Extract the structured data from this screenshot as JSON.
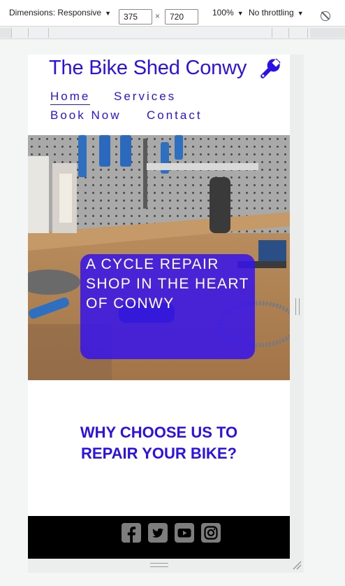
{
  "devtools": {
    "dimensions_label": "Dimensions: Responsive",
    "width_value": "375",
    "height_value": "720",
    "times_sign": "×",
    "zoom": "100%",
    "throttling": "No throttling",
    "caret": "▼"
  },
  "site": {
    "logo_text": "The Bike Shed Conwy",
    "logo_icon": "wrench-icon",
    "nav": {
      "home": "Home",
      "services": "Services",
      "book_now": "Book Now",
      "contact": "Contact"
    },
    "hero": {
      "headline": "A CYCLE REPAIR SHOP IN THE HEART OF CONWY"
    },
    "why_heading": "WHY CHOOSE US TO REPAIR YOUR BIKE?",
    "footer": {
      "social_icons": [
        "facebook-icon",
        "twitter-icon",
        "youtube-icon",
        "instagram-icon"
      ]
    }
  },
  "colors": {
    "brand_blue": "#2c10e8",
    "hero_overlay": "#3714eb",
    "footer_bg": "#000000",
    "social_icon": "#7d7d7d"
  }
}
